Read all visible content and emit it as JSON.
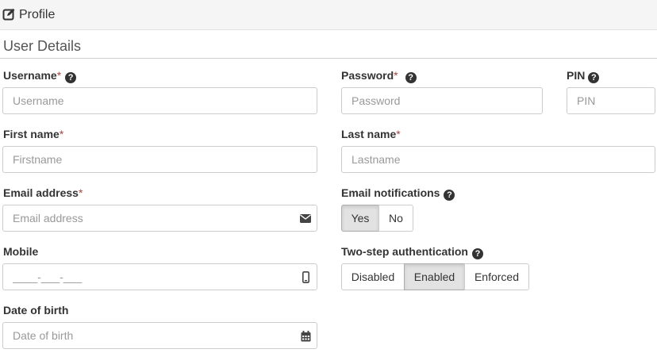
{
  "header": {
    "title": "Profile",
    "icon": "edit-icon"
  },
  "section": {
    "title": "User Details"
  },
  "form": {
    "username": {
      "label": "Username",
      "required": "*",
      "placeholder": "Username"
    },
    "password": {
      "label": "Password",
      "required": "*",
      "placeholder": "Password"
    },
    "pin": {
      "label": "PIN",
      "placeholder": "PIN"
    },
    "first_name": {
      "label": "First name",
      "required": "*",
      "placeholder": "Firstname"
    },
    "last_name": {
      "label": "Last name",
      "required": "*",
      "placeholder": "Lastname"
    },
    "email": {
      "label": "Email address",
      "required": "*",
      "placeholder": "Email address",
      "icon": "envelope-icon"
    },
    "email_notifications": {
      "label": "Email notifications",
      "options": [
        "Yes",
        "No"
      ],
      "selected": "Yes"
    },
    "mobile": {
      "label": "Mobile",
      "placeholder": "____-___-___",
      "icon": "mobile-phone-icon"
    },
    "two_step": {
      "label": "Two-step authentication",
      "options": [
        "Disabled",
        "Enabled",
        "Enforced"
      ],
      "selected": "Enabled"
    },
    "dob": {
      "label": "Date of birth",
      "placeholder": "Date of birth",
      "icon": "calendar-icon"
    }
  },
  "help_glyph": "?"
}
